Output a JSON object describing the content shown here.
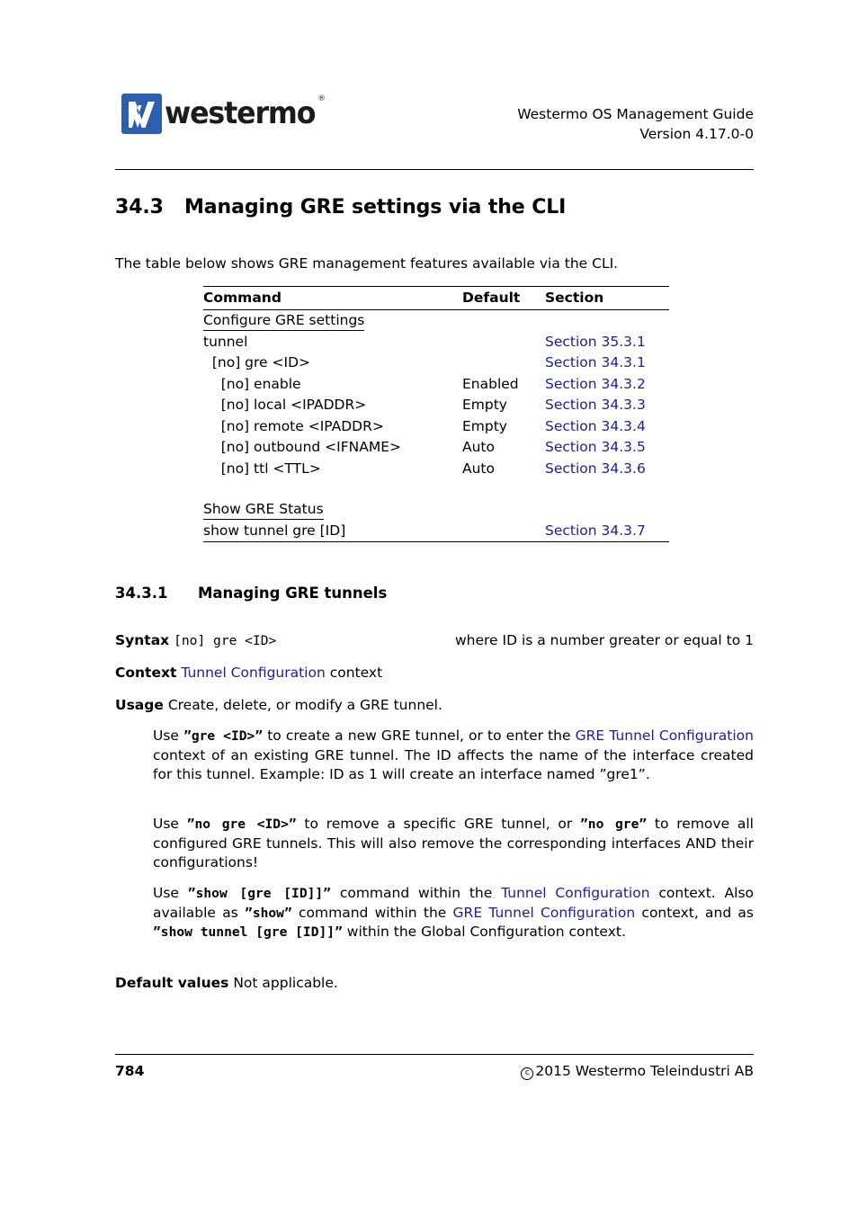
{
  "header": {
    "logo_word": "westermo",
    "logo_registered": "®",
    "title_line1": "Westermo OS Management Guide",
    "title_line2": "Version 4.17.0-0"
  },
  "footer": {
    "page_number": "784",
    "copyright_symbol": "c",
    "copyright": "2015 Westermo Teleindustri AB"
  },
  "section": {
    "number": "34.3",
    "title": "Managing GRE settings via the CLI",
    "intro": "The table below shows GRE management features available via the CLI."
  },
  "table": {
    "headers": {
      "command": "Command",
      "default": "Default",
      "section": "Section"
    },
    "group1_label": "Configure GRE settings",
    "group1_rows": [
      {
        "command": "tunnel",
        "default": "",
        "section": "Section 35.3.1"
      },
      {
        "command": "  [no] gre <ID>",
        "default": "",
        "section": "Section 34.3.1"
      },
      {
        "command": "    [no] enable",
        "default": "Enabled",
        "section": "Section 34.3.2"
      },
      {
        "command": "    [no] local <IPADDR>",
        "default": "Empty",
        "section": "Section 34.3.3"
      },
      {
        "command": "    [no] remote <IPADDR>",
        "default": "Empty",
        "section": "Section 34.3.4"
      },
      {
        "command": "    [no] outbound <IFNAME>",
        "default": "Auto",
        "section": "Section 34.3.5"
      },
      {
        "command": "    [no] ttl <TTL>",
        "default": "Auto",
        "section": "Section 34.3.6"
      }
    ],
    "group2_label": "Show GRE Status",
    "group2_rows": [
      {
        "command": "show tunnel gre [ID]",
        "default": "",
        "section": "Section 34.3.7"
      }
    ]
  },
  "subsection": {
    "number": "34.3.1",
    "title": "Managing GRE tunnels",
    "syntax_label": "Syntax",
    "syntax_command": "[no] gre <ID>",
    "syntax_note": "where ID is a number greater or equal to 1",
    "context_label": "Context",
    "context_link": "Tunnel Configuration",
    "context_tail": " context",
    "usage_label": "Usage",
    "usage_summary": "Create, delete, or modify a GRE tunnel.",
    "para1": {
      "t1": "Use ",
      "cmd1": "”gre <ID>”",
      "t2": " to create a new GRE tunnel, or to enter the ",
      "link1": "GRE Tunnel Configuration",
      "t3": " context of an existing GRE tunnel.  The ID affects the name of the interface created for this tunnel.  Example: ID as 1 will create an interface named ”gre1”."
    },
    "para2": {
      "t1": "Use ",
      "cmd1": "”no gre <ID>”",
      "t2": " to remove a specific GRE tunnel, or ",
      "cmd2": "”no gre”",
      "t3": " to remove all configured GRE tunnels.  This will also remove the corresponding interfaces AND their configurations!"
    },
    "para3": {
      "t1": "Use ",
      "cmd1": "”show [gre [ID]]”",
      "t2": " command within the ",
      "link1": "Tunnel Configuration",
      "t3": " context.  Also available as ",
      "cmd2": "”show”",
      "t4": " command within the ",
      "link2": "GRE Tunnel Configuration",
      "t5": " context, and as ",
      "cmd3": "”show tunnel [gre [ID]]”",
      "t6": " within the Global Configuration context."
    },
    "defaults_label": "Default values",
    "defaults_value": "Not applicable."
  },
  "colors": {
    "link": "#1c1ca0",
    "logo_blue": "#2c60ad"
  }
}
